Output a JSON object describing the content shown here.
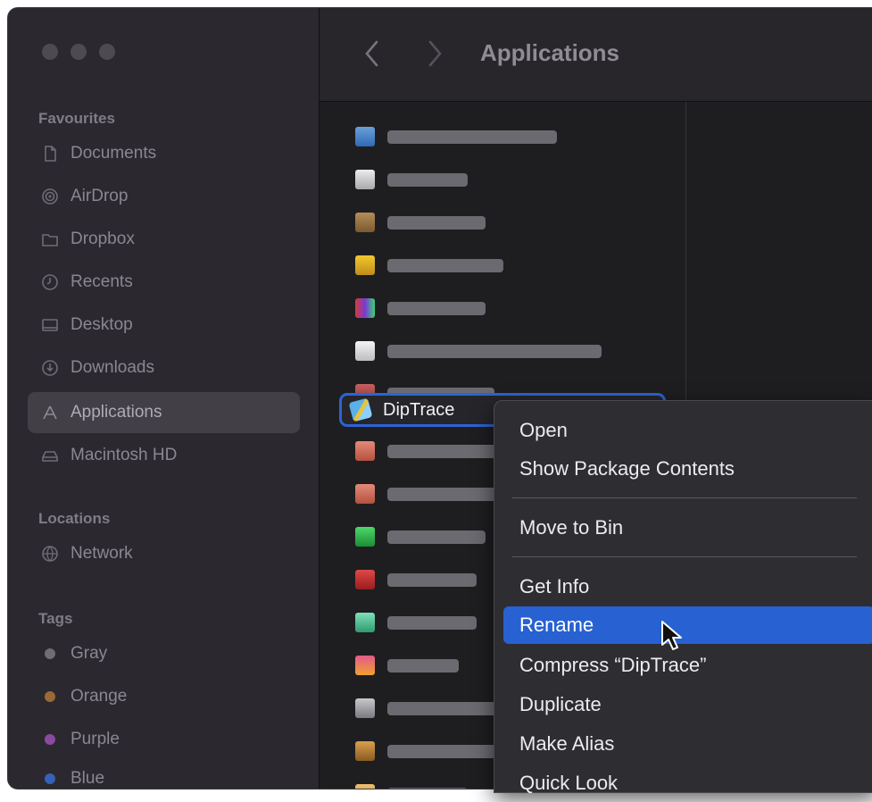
{
  "window": {
    "title": "Applications"
  },
  "sidebar": {
    "sections": {
      "favourites": "Favourites",
      "locations": "Locations",
      "tags": "Tags"
    },
    "favourites": [
      {
        "label": "Documents",
        "icon": "document-icon"
      },
      {
        "label": "AirDrop",
        "icon": "airdrop-icon"
      },
      {
        "label": "Dropbox",
        "icon": "folder-icon"
      },
      {
        "label": "Recents",
        "icon": "clock-icon"
      },
      {
        "label": "Desktop",
        "icon": "desktop-icon"
      },
      {
        "label": "Downloads",
        "icon": "download-icon"
      },
      {
        "label": "Applications",
        "icon": "applications-icon",
        "selected": true
      },
      {
        "label": "Macintosh HD",
        "icon": "drive-icon"
      }
    ],
    "locations": [
      {
        "label": "Network",
        "icon": "network-icon"
      }
    ],
    "tags": [
      {
        "label": "Gray",
        "color": "#8e8e93"
      },
      {
        "label": "Orange",
        "color": "#c9863d"
      },
      {
        "label": "Purple",
        "color": "#b05ac9"
      },
      {
        "label": "Blue",
        "color": "#3f74d6"
      }
    ]
  },
  "files": {
    "selected": "DipTrace"
  },
  "context_menu": {
    "items": {
      "open": "Open",
      "show_package": "Show Package Contents",
      "move_to_bin": "Move to Bin",
      "get_info": "Get Info",
      "rename": "Rename",
      "compress": "Compress “DipTrace”",
      "duplicate": "Duplicate",
      "make_alias": "Make Alias",
      "quick_look": "Quick Look"
    },
    "highlighted": "Rename",
    "highlight_color": "#2761d2"
  },
  "colors": {
    "selection_border": "#2b64d4"
  }
}
